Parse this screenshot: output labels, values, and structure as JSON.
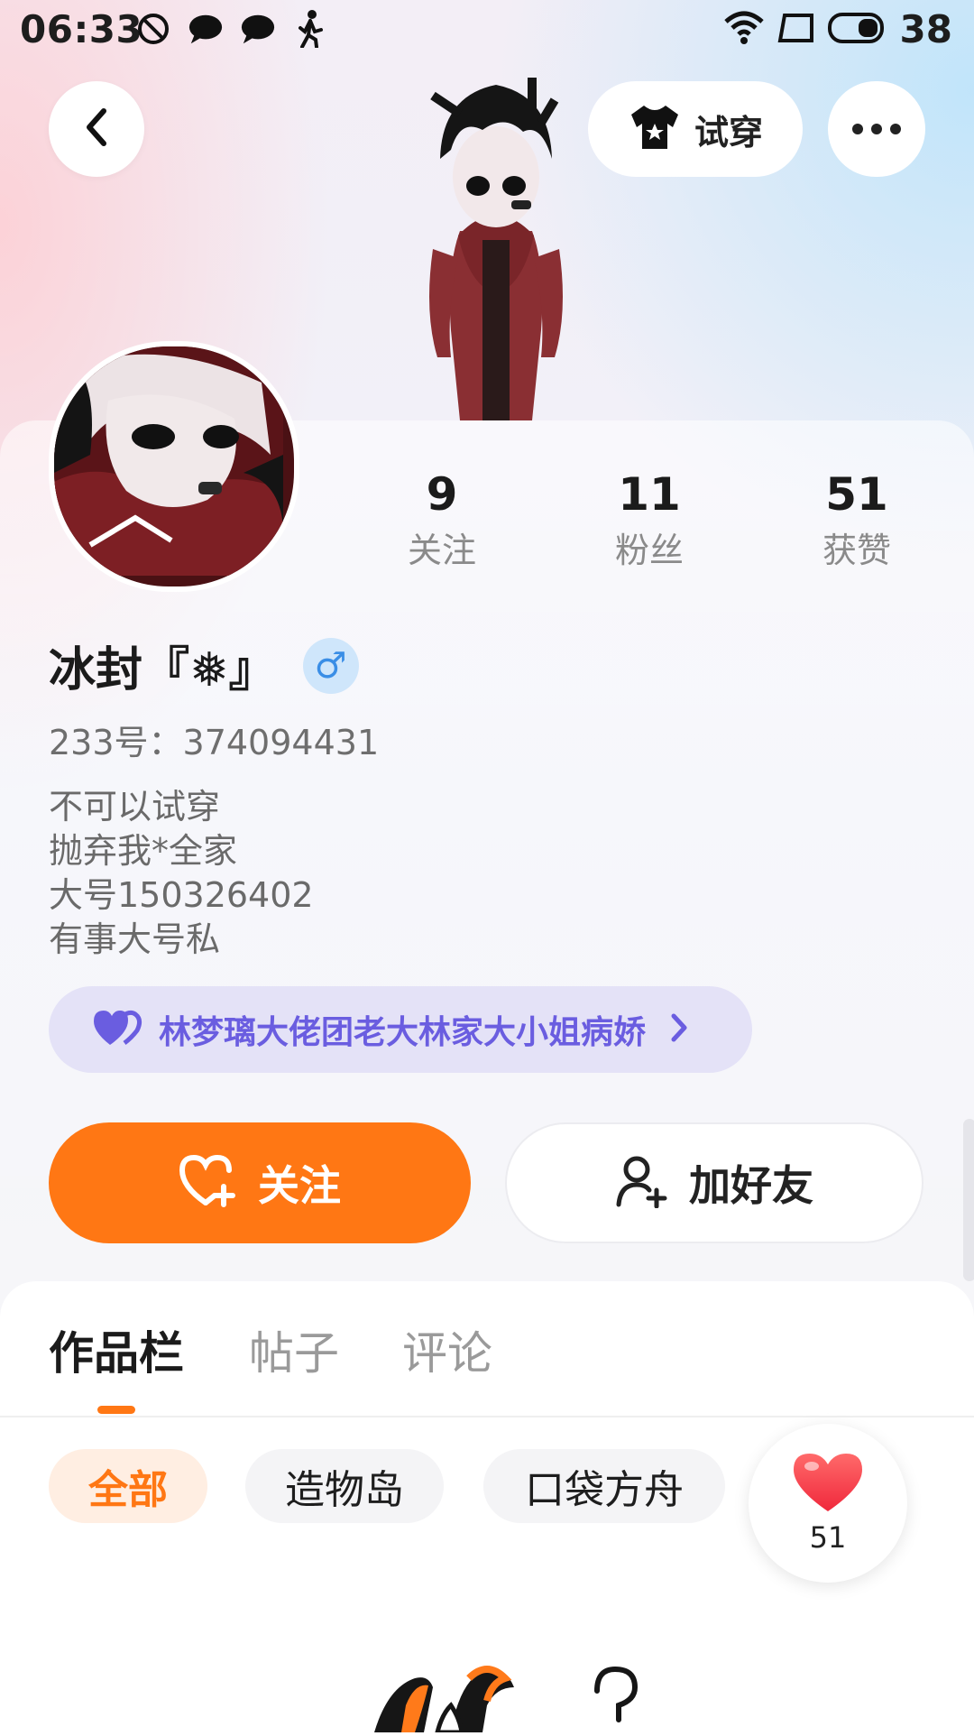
{
  "status_bar": {
    "time": "06:33",
    "battery": "38"
  },
  "header": {
    "tryon_label": "试穿"
  },
  "profile": {
    "username": "冰封『❅』",
    "gender_symbol": "♂",
    "account_id": "233号：374094431",
    "bio": [
      "不可以试穿",
      "抛弃我*全家",
      "大号150326402",
      "有事大号私"
    ],
    "group": "林梦璃大佬团老大林家大小姐病娇"
  },
  "stats": [
    {
      "value": "9",
      "label": "关注"
    },
    {
      "value": "11",
      "label": "粉丝"
    },
    {
      "value": "51",
      "label": "获赞"
    }
  ],
  "actions": {
    "follow": "关注",
    "add_friend": "加好友"
  },
  "tabs": [
    {
      "label": "作品栏",
      "active": true
    },
    {
      "label": "帖子",
      "active": false
    },
    {
      "label": "评论",
      "active": false
    }
  ],
  "filters": [
    {
      "label": "全部",
      "active": true
    },
    {
      "label": "造物岛",
      "active": false
    },
    {
      "label": "口袋方舟",
      "active": false
    }
  ],
  "like_bubble": {
    "count": "51"
  },
  "colors": {
    "accent": "#ff7714",
    "group_text": "#6a5de0",
    "group_bg": "#e4e2f7",
    "gender": "#3a8ee6"
  },
  "icons": [
    "dnd-icon",
    "chat-icon",
    "walk-icon",
    "wifi-icon",
    "battery-icon",
    "back-icon",
    "shirt-icon",
    "more-icon",
    "heart-icon",
    "add-user-icon",
    "chevron-right-icon"
  ]
}
